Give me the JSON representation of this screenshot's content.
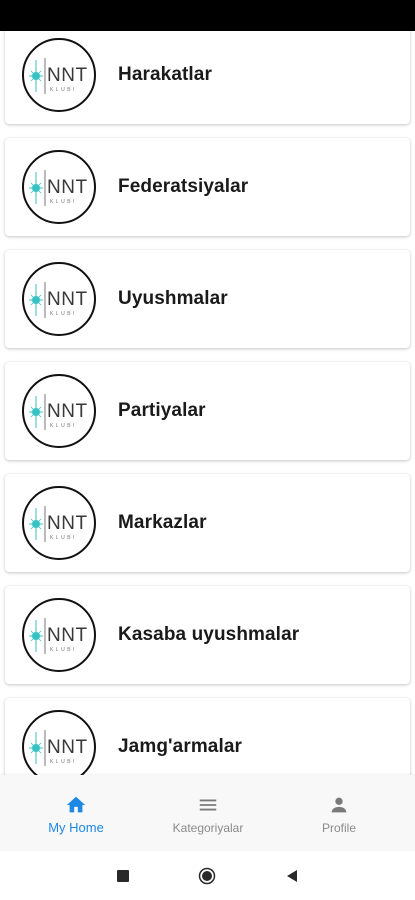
{
  "list": {
    "items": [
      {
        "label": "Harakatlar",
        "logo_text": "NNT",
        "logo_subtext": "KLUBI"
      },
      {
        "label": "Federatsiyalar",
        "logo_text": "NNT",
        "logo_subtext": "KLUBI"
      },
      {
        "label": "Uyushmalar",
        "logo_text": "NNT",
        "logo_subtext": "KLUBI"
      },
      {
        "label": "Partiyalar",
        "logo_text": "NNT",
        "logo_subtext": "KLUBI"
      },
      {
        "label": "Markazlar",
        "logo_text": "NNT",
        "logo_subtext": "KLUBI"
      },
      {
        "label": "Kasaba uyushmalar",
        "logo_text": "NNT",
        "logo_subtext": "KLUBI"
      },
      {
        "label": "Jamg'armalar",
        "logo_text": "NNT",
        "logo_subtext": "KLUBI"
      }
    ]
  },
  "bottom_nav": {
    "home_label": "My Home",
    "categories_label": "Kategoriyalar",
    "profile_label": "Profile",
    "active_tab": "home",
    "active_color": "#1e88e5",
    "inactive_color": "#8a8a8a",
    "home_icon": "home-icon",
    "categories_icon": "menu-icon",
    "profile_icon": "person-icon"
  },
  "colors": {
    "logo_accent": "#36c2c2",
    "status_bar": "#000000",
    "nav_background": "#f8f8f8"
  }
}
